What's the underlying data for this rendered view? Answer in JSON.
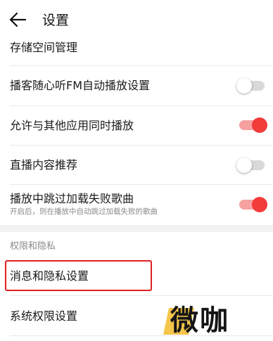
{
  "header": {
    "title": "设置",
    "back_icon": "arrow-left-icon"
  },
  "rows": {
    "storage": {
      "label": "存储空间管理"
    },
    "podcast_fm": {
      "label": "播客随心听FM自动播放设置",
      "toggle_on": false
    },
    "allow_other_apps": {
      "label": "允许与其他应用同时播放",
      "toggle_on": true
    },
    "live_recommend": {
      "label": "直播内容推荐",
      "toggle_on": false
    },
    "skip_failed": {
      "label": "播放中跳过加载失败歌曲",
      "sublabel": "开启后，则在播放中自动跳过加载失败的歌曲",
      "toggle_on": true
    }
  },
  "privacy_section": {
    "title": "权限和隐私",
    "message_privacy_label": "消息和隐私设置",
    "system_permission_label": "系统权限设置"
  },
  "watermark": {
    "text": "微咖"
  },
  "colors": {
    "toggle_on_knob": "#f23b3b",
    "toggle_on_track": "#f7a0a0",
    "toggle_off_track": "#d9d9d9",
    "highlight_border": "#e02020",
    "watermark_accent": "#f4c54b"
  }
}
